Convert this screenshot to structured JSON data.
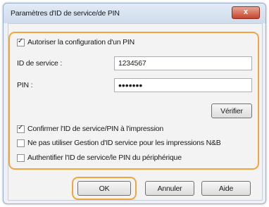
{
  "dialog": {
    "title": "Paramètres d'ID de service/de PIN",
    "close_label": "x"
  },
  "allow_pin": {
    "label": "Autoriser la configuration d'un PIN",
    "checked": true
  },
  "service_id": {
    "label": "ID de service :",
    "value": "1234567"
  },
  "pin": {
    "label": "PIN :",
    "value": "•••••••"
  },
  "verify_button": "Vérifier",
  "options": [
    {
      "label": "Confirmer l'ID de service/PIN à l'impression",
      "checked": true
    },
    {
      "label": "Ne pas utiliser Gestion d'ID service pour les impressions N&B",
      "checked": false
    },
    {
      "label": "Authentifier l'ID de service/le PIN du périphérique",
      "checked": false
    }
  ],
  "footer": {
    "ok": "OK",
    "cancel": "Annuler",
    "help": "Aide"
  },
  "colors": {
    "highlight": "#f0a63c",
    "close_button": "#c6442d"
  }
}
